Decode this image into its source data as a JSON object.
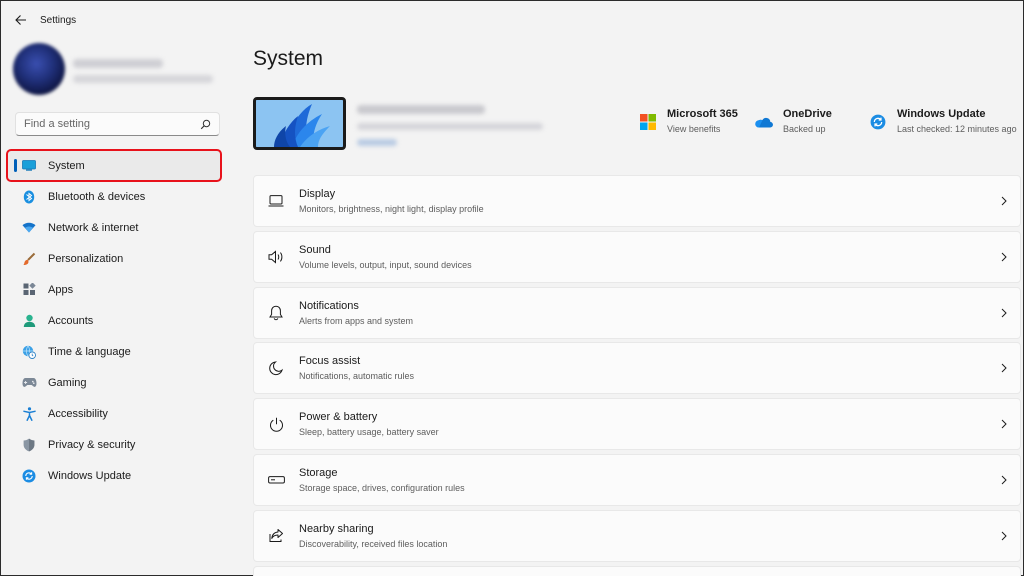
{
  "app": {
    "title": "Settings"
  },
  "search": {
    "placeholder": "Find a setting"
  },
  "sidebar": {
    "items": [
      {
        "label": "System",
        "icon": "system-icon"
      },
      {
        "label": "Bluetooth & devices",
        "icon": "bluetooth-icon"
      },
      {
        "label": "Network & internet",
        "icon": "wifi-icon"
      },
      {
        "label": "Personalization",
        "icon": "brush-icon"
      },
      {
        "label": "Apps",
        "icon": "apps-icon"
      },
      {
        "label": "Accounts",
        "icon": "accounts-icon"
      },
      {
        "label": "Time & language",
        "icon": "globe-clock-icon"
      },
      {
        "label": "Gaming",
        "icon": "gamepad-icon"
      },
      {
        "label": "Accessibility",
        "icon": "accessibility-icon"
      },
      {
        "label": "Privacy & security",
        "icon": "shield-icon"
      },
      {
        "label": "Windows Update",
        "icon": "windows-update-icon"
      }
    ],
    "active_index": 0
  },
  "main": {
    "title": "System",
    "quick_links": [
      {
        "title": "Microsoft 365",
        "subtitle": "View benefits",
        "icon": "microsoft-365-icon"
      },
      {
        "title": "OneDrive",
        "subtitle": "Backed up",
        "icon": "onedrive-icon"
      },
      {
        "title": "Windows Update",
        "subtitle": "Last checked: 12 minutes ago",
        "icon": "windows-update-icon"
      }
    ],
    "cards": [
      {
        "title": "Display",
        "subtitle": "Monitors, brightness, night light, display profile",
        "icon": "display-icon"
      },
      {
        "title": "Sound",
        "subtitle": "Volume levels, output, input, sound devices",
        "icon": "speaker-icon"
      },
      {
        "title": "Notifications",
        "subtitle": "Alerts from apps and system",
        "icon": "bell-icon"
      },
      {
        "title": "Focus assist",
        "subtitle": "Notifications, automatic rules",
        "icon": "moon-icon"
      },
      {
        "title": "Power & battery",
        "subtitle": "Sleep, battery usage, battery saver",
        "icon": "power-icon"
      },
      {
        "title": "Storage",
        "subtitle": "Storage space, drives, configuration rules",
        "icon": "storage-icon"
      },
      {
        "title": "Nearby sharing",
        "subtitle": "Discoverability, received files location",
        "icon": "share-icon"
      }
    ]
  },
  "colors": {
    "accent": "#005fb8",
    "highlight_box": "#e8121b",
    "background": "#f3f3f3",
    "card": "#fbfbfb"
  }
}
